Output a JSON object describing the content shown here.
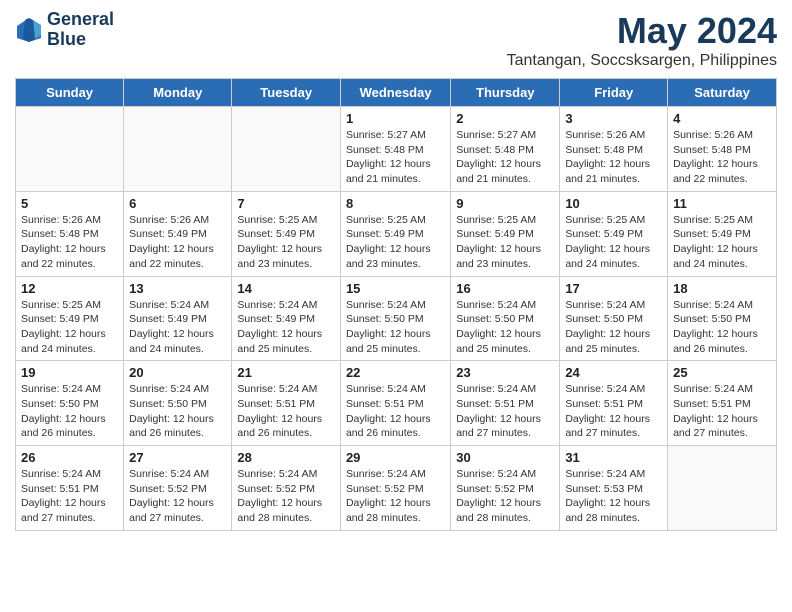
{
  "header": {
    "logo_line1": "General",
    "logo_line2": "Blue",
    "main_title": "May 2024",
    "subtitle": "Tantangan, Soccsksargen, Philippines"
  },
  "days_of_week": [
    "Sunday",
    "Monday",
    "Tuesday",
    "Wednesday",
    "Thursday",
    "Friday",
    "Saturday"
  ],
  "weeks": [
    [
      {
        "day": "",
        "info": "",
        "empty": true
      },
      {
        "day": "",
        "info": "",
        "empty": true
      },
      {
        "day": "",
        "info": "",
        "empty": true
      },
      {
        "day": "1",
        "info": "Sunrise: 5:27 AM\nSunset: 5:48 PM\nDaylight: 12 hours\nand 21 minutes.",
        "empty": false
      },
      {
        "day": "2",
        "info": "Sunrise: 5:27 AM\nSunset: 5:48 PM\nDaylight: 12 hours\nand 21 minutes.",
        "empty": false
      },
      {
        "day": "3",
        "info": "Sunrise: 5:26 AM\nSunset: 5:48 PM\nDaylight: 12 hours\nand 21 minutes.",
        "empty": false
      },
      {
        "day": "4",
        "info": "Sunrise: 5:26 AM\nSunset: 5:48 PM\nDaylight: 12 hours\nand 22 minutes.",
        "empty": false
      }
    ],
    [
      {
        "day": "5",
        "info": "Sunrise: 5:26 AM\nSunset: 5:48 PM\nDaylight: 12 hours\nand 22 minutes.",
        "empty": false
      },
      {
        "day": "6",
        "info": "Sunrise: 5:26 AM\nSunset: 5:49 PM\nDaylight: 12 hours\nand 22 minutes.",
        "empty": false
      },
      {
        "day": "7",
        "info": "Sunrise: 5:25 AM\nSunset: 5:49 PM\nDaylight: 12 hours\nand 23 minutes.",
        "empty": false
      },
      {
        "day": "8",
        "info": "Sunrise: 5:25 AM\nSunset: 5:49 PM\nDaylight: 12 hours\nand 23 minutes.",
        "empty": false
      },
      {
        "day": "9",
        "info": "Sunrise: 5:25 AM\nSunset: 5:49 PM\nDaylight: 12 hours\nand 23 minutes.",
        "empty": false
      },
      {
        "day": "10",
        "info": "Sunrise: 5:25 AM\nSunset: 5:49 PM\nDaylight: 12 hours\nand 24 minutes.",
        "empty": false
      },
      {
        "day": "11",
        "info": "Sunrise: 5:25 AM\nSunset: 5:49 PM\nDaylight: 12 hours\nand 24 minutes.",
        "empty": false
      }
    ],
    [
      {
        "day": "12",
        "info": "Sunrise: 5:25 AM\nSunset: 5:49 PM\nDaylight: 12 hours\nand 24 minutes.",
        "empty": false
      },
      {
        "day": "13",
        "info": "Sunrise: 5:24 AM\nSunset: 5:49 PM\nDaylight: 12 hours\nand 24 minutes.",
        "empty": false
      },
      {
        "day": "14",
        "info": "Sunrise: 5:24 AM\nSunset: 5:49 PM\nDaylight: 12 hours\nand 25 minutes.",
        "empty": false
      },
      {
        "day": "15",
        "info": "Sunrise: 5:24 AM\nSunset: 5:50 PM\nDaylight: 12 hours\nand 25 minutes.",
        "empty": false
      },
      {
        "day": "16",
        "info": "Sunrise: 5:24 AM\nSunset: 5:50 PM\nDaylight: 12 hours\nand 25 minutes.",
        "empty": false
      },
      {
        "day": "17",
        "info": "Sunrise: 5:24 AM\nSunset: 5:50 PM\nDaylight: 12 hours\nand 25 minutes.",
        "empty": false
      },
      {
        "day": "18",
        "info": "Sunrise: 5:24 AM\nSunset: 5:50 PM\nDaylight: 12 hours\nand 26 minutes.",
        "empty": false
      }
    ],
    [
      {
        "day": "19",
        "info": "Sunrise: 5:24 AM\nSunset: 5:50 PM\nDaylight: 12 hours\nand 26 minutes.",
        "empty": false
      },
      {
        "day": "20",
        "info": "Sunrise: 5:24 AM\nSunset: 5:50 PM\nDaylight: 12 hours\nand 26 minutes.",
        "empty": false
      },
      {
        "day": "21",
        "info": "Sunrise: 5:24 AM\nSunset: 5:51 PM\nDaylight: 12 hours\nand 26 minutes.",
        "empty": false
      },
      {
        "day": "22",
        "info": "Sunrise: 5:24 AM\nSunset: 5:51 PM\nDaylight: 12 hours\nand 26 minutes.",
        "empty": false
      },
      {
        "day": "23",
        "info": "Sunrise: 5:24 AM\nSunset: 5:51 PM\nDaylight: 12 hours\nand 27 minutes.",
        "empty": false
      },
      {
        "day": "24",
        "info": "Sunrise: 5:24 AM\nSunset: 5:51 PM\nDaylight: 12 hours\nand 27 minutes.",
        "empty": false
      },
      {
        "day": "25",
        "info": "Sunrise: 5:24 AM\nSunset: 5:51 PM\nDaylight: 12 hours\nand 27 minutes.",
        "empty": false
      }
    ],
    [
      {
        "day": "26",
        "info": "Sunrise: 5:24 AM\nSunset: 5:51 PM\nDaylight: 12 hours\nand 27 minutes.",
        "empty": false
      },
      {
        "day": "27",
        "info": "Sunrise: 5:24 AM\nSunset: 5:52 PM\nDaylight: 12 hours\nand 27 minutes.",
        "empty": false
      },
      {
        "day": "28",
        "info": "Sunrise: 5:24 AM\nSunset: 5:52 PM\nDaylight: 12 hours\nand 28 minutes.",
        "empty": false
      },
      {
        "day": "29",
        "info": "Sunrise: 5:24 AM\nSunset: 5:52 PM\nDaylight: 12 hours\nand 28 minutes.",
        "empty": false
      },
      {
        "day": "30",
        "info": "Sunrise: 5:24 AM\nSunset: 5:52 PM\nDaylight: 12 hours\nand 28 minutes.",
        "empty": false
      },
      {
        "day": "31",
        "info": "Sunrise: 5:24 AM\nSunset: 5:53 PM\nDaylight: 12 hours\nand 28 minutes.",
        "empty": false
      },
      {
        "day": "",
        "info": "",
        "empty": true
      }
    ]
  ]
}
